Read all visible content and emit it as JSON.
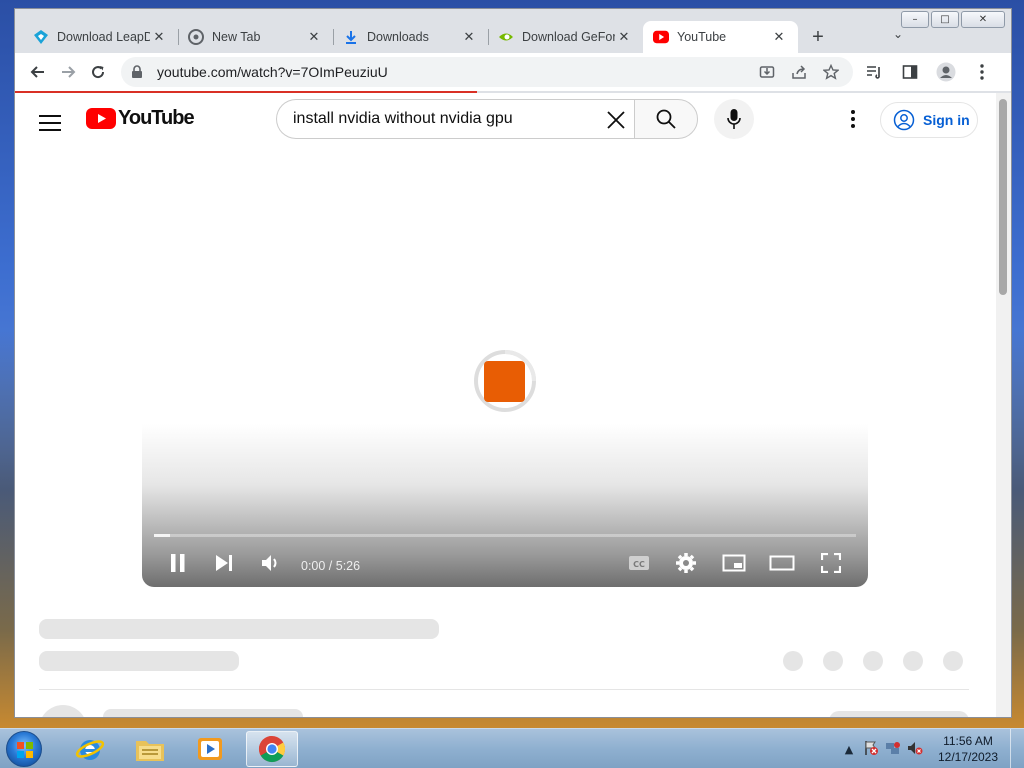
{
  "browser": {
    "tabs": [
      {
        "title": "Download LeapD",
        "favicon": "leapdroid-icon",
        "active": false
      },
      {
        "title": "New Tab",
        "favicon": "chrome-icon",
        "active": false
      },
      {
        "title": "Downloads",
        "favicon": "download-icon",
        "active": false
      },
      {
        "title": "Download GeFor",
        "favicon": "nvidia-icon",
        "active": false
      },
      {
        "title": "YouTube",
        "favicon": "youtube-icon",
        "active": true
      }
    ],
    "url": "youtube.com/watch?v=7OImPeuziuU",
    "accent_loading": "#d93025"
  },
  "youtube": {
    "logo_text": "YouTube",
    "search_query": "install nvidia without nvidia gpu",
    "signin_label": "Sign in",
    "brand_color": "#ff0000",
    "link_color": "#065fd4"
  },
  "player": {
    "time": "0:00 / 5:26",
    "spinner_color": "#e85d04"
  },
  "taskbar": {
    "clock_time": "11:56 AM",
    "clock_date": "12/17/2023"
  }
}
